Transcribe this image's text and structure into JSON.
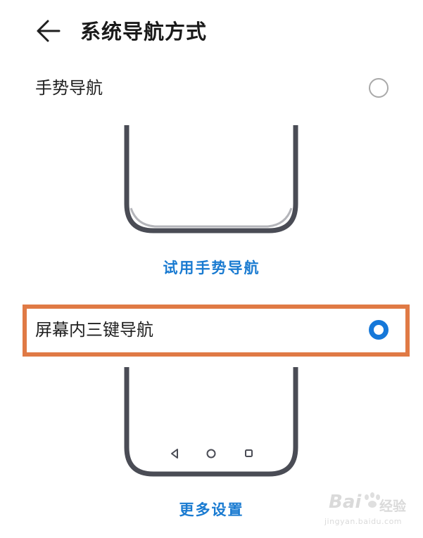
{
  "header": {
    "title": "系统导航方式",
    "back_icon": "arrow-left-icon"
  },
  "options": [
    {
      "label": "手势导航",
      "selected": false,
      "action_label": "试用手势导航"
    },
    {
      "label": "屏幕内三键导航",
      "selected": true,
      "highlighted": true,
      "action_label": "更多设置",
      "nav_keys": [
        "triangle-back-icon",
        "circle-home-icon",
        "square-recents-icon"
      ]
    }
  ],
  "colors": {
    "accent": "#1678d9",
    "link": "#1a7bd1",
    "highlight_border": "#e07a45",
    "phone_frame": "#4a4c55",
    "radio_off": "#a9a9a9"
  },
  "watermark": {
    "brand": "Bai",
    "brand_suffix": "经验",
    "url": "jingyan.baidu.com"
  }
}
